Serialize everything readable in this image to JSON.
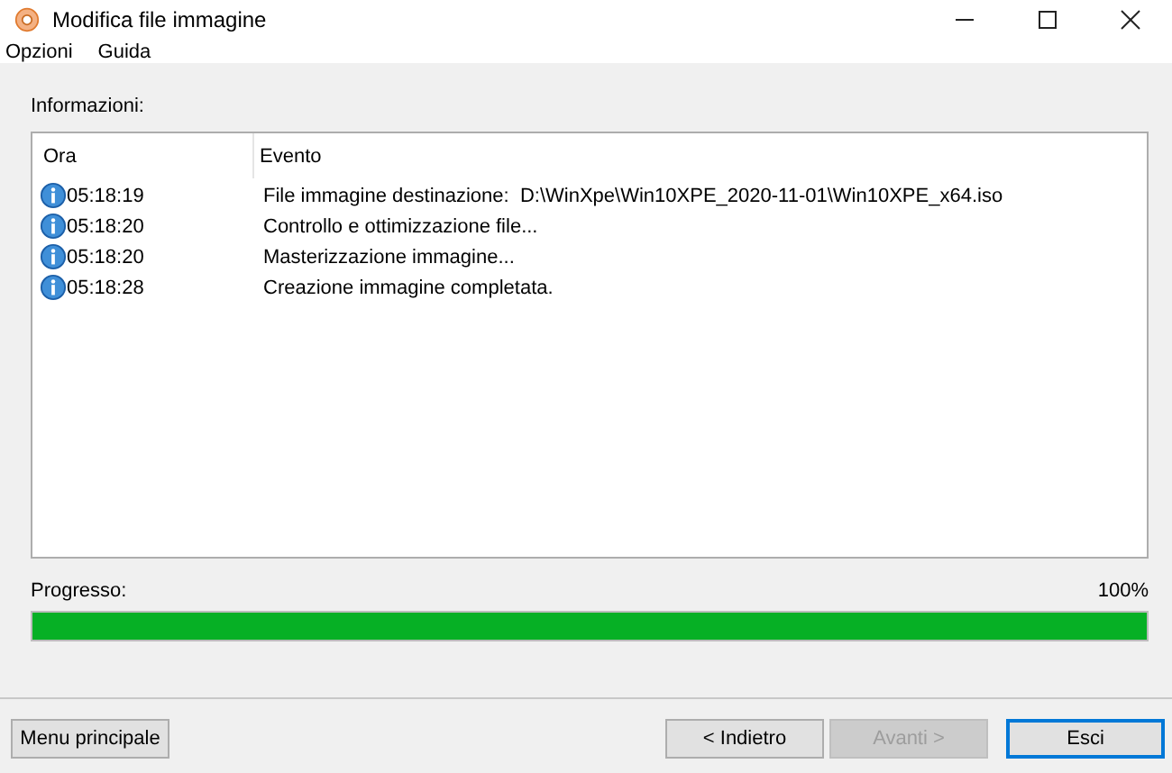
{
  "window": {
    "title": "Modifica file immagine"
  },
  "menu": [
    "Opzioni",
    "Guida"
  ],
  "log": {
    "label": "Informazioni:",
    "columns": [
      "Ora",
      "Evento"
    ],
    "rows": [
      {
        "time": "05:18:19",
        "event": "File immagine destinazione:  D:\\WinXpe\\Win10XPE_2020-11-01\\Win10XPE_x64.iso"
      },
      {
        "time": "05:18:20",
        "event": "Controllo e ottimizzazione file..."
      },
      {
        "time": "05:18:20",
        "event": "Masterizzazione immagine..."
      },
      {
        "time": "05:18:28",
        "event": "Creazione immagine completata."
      }
    ]
  },
  "progress": {
    "label": "Progresso:",
    "reading": "100%",
    "level": 1
  },
  "buttons": [
    {
      "label": "Menu principale",
      "disabled": false,
      "default": false
    },
    {
      "label": "< Indietro",
      "disabled": false,
      "default": false
    },
    {
      "label": "Avanti >",
      "disabled": true,
      "default": false
    },
    {
      "label": "Esci",
      "disabled": false,
      "default": true
    }
  ]
}
